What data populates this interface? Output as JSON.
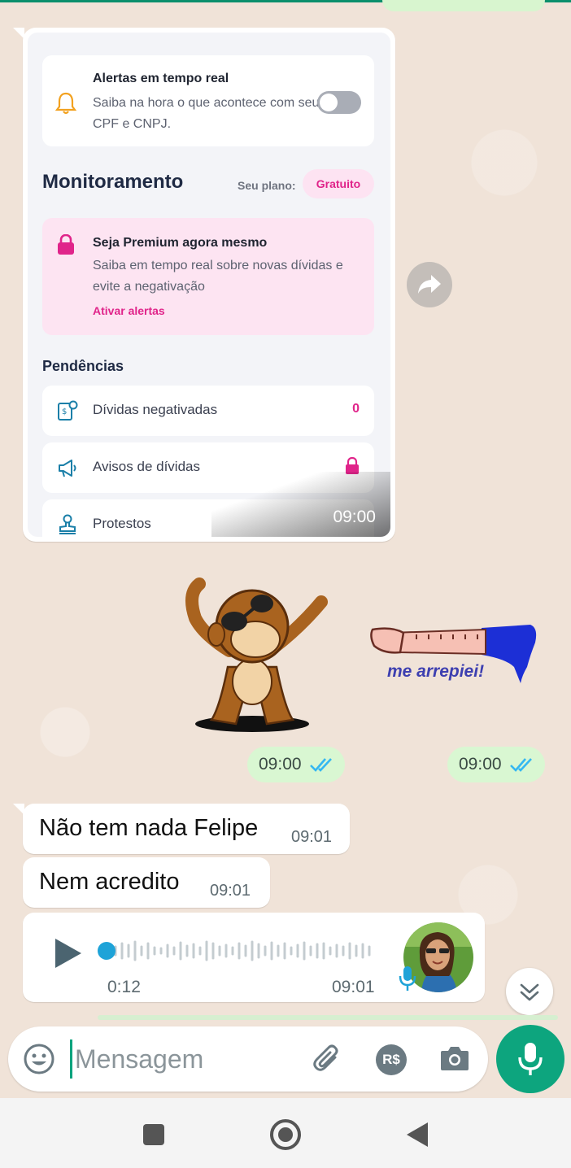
{
  "screenshot": {
    "alert": {
      "title": "Alertas em tempo real",
      "description": "Saiba na hora o que acontece com seu CPF e CNPJ."
    },
    "monitor": {
      "title": "Monitoramento",
      "plan_label": "Seu plano:",
      "plan_value": "Gratuito"
    },
    "premium": {
      "title": "Seja Premium agora mesmo",
      "description": "Saiba em tempo real sobre novas dívidas e evite a negativação",
      "link": "Ativar alertas"
    },
    "pendencias": {
      "title": "Pendências",
      "rows": [
        {
          "label": "Dívidas negativadas",
          "value": "0",
          "icon": "document-money-icon"
        },
        {
          "label": "Avisos de dívidas",
          "icon": "megaphone-icon",
          "locked": true
        },
        {
          "label": "Protestos",
          "icon": "stamp-icon"
        }
      ]
    },
    "time": "09:00"
  },
  "stickers": {
    "monkey_time": "09:00",
    "arm_text": "me arrepiei!",
    "arm_time": "09:00"
  },
  "messages": [
    {
      "text": "Não tem nada Felipe",
      "time": "09:01"
    },
    {
      "text": "Nem acredito",
      "time": "09:01"
    }
  ],
  "audio": {
    "duration": "0:12",
    "time": "09:01",
    "progress": 0
  },
  "composer": {
    "placeholder": "Mensagem",
    "pay_label": "R$"
  },
  "colors": {
    "accent_pink": "#e0248a",
    "whatsapp_green": "#0da57e",
    "outgoing_bubble": "#d9f7d2",
    "read_ticks": "#34b7f1"
  }
}
